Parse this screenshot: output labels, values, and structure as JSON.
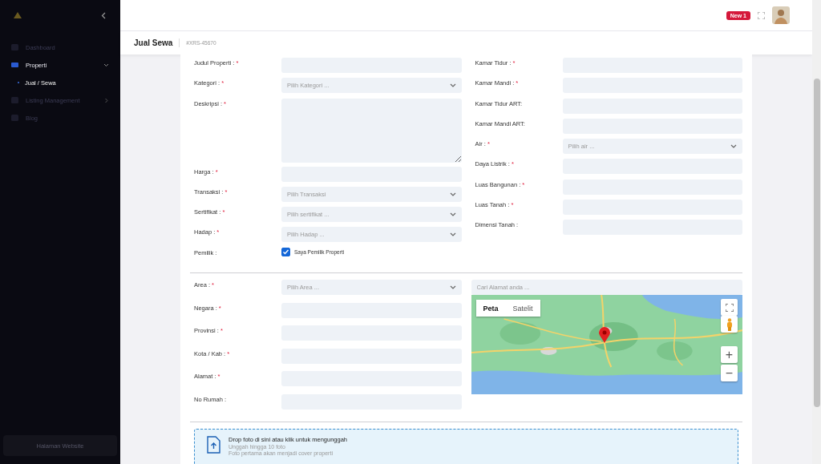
{
  "sidebar": {
    "items": [
      {
        "label": "Dashboard",
        "selected": false
      },
      {
        "label": "Properti",
        "selected": true,
        "expanded": true,
        "children": [
          {
            "label": "Jual / Sewa",
            "selected": true
          }
        ]
      },
      {
        "label": "Listing Management",
        "selected": false,
        "expanded": false
      },
      {
        "label": "Blog",
        "selected": false
      }
    ],
    "footer_button": "Halaman Website"
  },
  "header": {
    "badge": "New 1"
  },
  "page": {
    "title": "Jual Sewa",
    "code": "#XRS-45670"
  },
  "form": {
    "left": [
      {
        "label": "Judul Properti :",
        "asterisk": "*",
        "kind": "input"
      },
      {
        "label": "Kategori :",
        "asterisk": "*",
        "kind": "select",
        "placeholder": "Pilih Kategori ..."
      },
      {
        "label": "Deskripsi :",
        "asterisk": "*",
        "kind": "textarea"
      },
      {
        "label": "Harga :",
        "asterisk": "*",
        "kind": "input"
      },
      {
        "label": "Transaksi :",
        "asterisk": "*",
        "kind": "select",
        "placeholder": "Pilih Transaksi"
      },
      {
        "label": "Sertifikat :",
        "asterisk": "*",
        "kind": "select",
        "placeholder": "Pilih sertifikat ..."
      },
      {
        "label": "Hadap :",
        "asterisk": "*",
        "kind": "select",
        "placeholder": "Pilih Hadap ..."
      },
      {
        "label": "Pemilik :",
        "kind": "checkbox",
        "text": "Saya Pemilik Properti",
        "checked": true
      }
    ],
    "right": [
      {
        "label": "Kamar Tidur :",
        "asterisk": "*",
        "kind": "input"
      },
      {
        "label": "Kamar Mandi :",
        "asterisk": "*",
        "kind": "input"
      },
      {
        "label": "Kamar Tidur ART:",
        "kind": "input"
      },
      {
        "label": "Kamar Mandi ART:",
        "kind": "input"
      },
      {
        "label": "Air :",
        "asterisk": "*",
        "kind": "select",
        "placeholder": "Pilih air ..."
      },
      {
        "label": "Daya Listrik :",
        "asterisk": "*",
        "kind": "input"
      },
      {
        "label": "Luas Bangunan :",
        "asterisk": "*",
        "kind": "input"
      },
      {
        "label": "Luas Tanah :",
        "asterisk": "*",
        "kind": "input"
      },
      {
        "label": "Dimensi Tanah :",
        "kind": "input"
      }
    ],
    "address": [
      {
        "label": "Area :",
        "asterisk": "*",
        "kind": "select",
        "placeholder": "Pilih Area ..."
      },
      {
        "label": "Negara :",
        "asterisk": "*",
        "kind": "input"
      },
      {
        "label": "Provinsi :",
        "asterisk": "*",
        "kind": "input"
      },
      {
        "label": "Kota / Kab :",
        "asterisk": "*",
        "kind": "input"
      },
      {
        "label": "Alamat :",
        "asterisk": "*",
        "kind": "input"
      },
      {
        "label": "No Rumah :",
        "kind": "input"
      }
    ]
  },
  "map": {
    "search_placeholder": "Cari Alamat anda ...",
    "tabs": [
      {
        "label": "Peta",
        "selected": true
      },
      {
        "label": "Satelit",
        "selected": false
      }
    ],
    "zoom_in": "+",
    "zoom_out": "−"
  },
  "upload": {
    "title": "Drop foto di sini atau klik untuk mengunggah",
    "hint": "Unggah hingga 10 foto",
    "note": "Foto pertama akan menjadi cover properti"
  }
}
